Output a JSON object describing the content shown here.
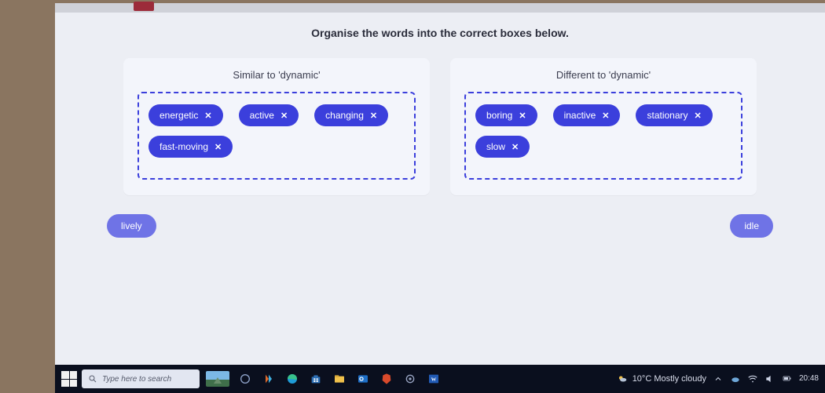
{
  "instruction": "Organise the words into the correct boxes below.",
  "groups": {
    "similar": {
      "title": "Similar to 'dynamic'",
      "pills": [
        "energetic",
        "active",
        "changing",
        "fast-moving"
      ]
    },
    "different": {
      "title": "Different to 'dynamic'",
      "pills": [
        "boring",
        "inactive",
        "stationary",
        "slow"
      ]
    }
  },
  "remaining": {
    "left": "lively",
    "right": "idle"
  },
  "taskbar": {
    "search_placeholder": "Type here to search",
    "weather_text": "10°C  Mostly cloudy",
    "clock": "20:48"
  },
  "colors": {
    "accent": "#3b3fdc",
    "accent_light": "#6f73e6"
  }
}
